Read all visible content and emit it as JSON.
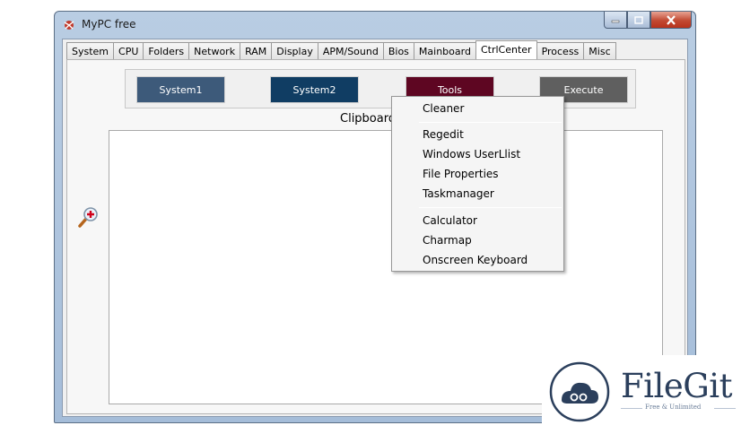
{
  "window": {
    "title": "MyPC free"
  },
  "tabs": [
    {
      "label": "System"
    },
    {
      "label": "CPU"
    },
    {
      "label": "Folders"
    },
    {
      "label": "Network"
    },
    {
      "label": "RAM"
    },
    {
      "label": "Display"
    },
    {
      "label": "APM/Sound"
    },
    {
      "label": "Bios"
    },
    {
      "label": "Mainboard"
    },
    {
      "label": "CtrlCenter",
      "active": true
    },
    {
      "label": "Process"
    },
    {
      "label": "Misc"
    }
  ],
  "buttons": {
    "system1": "System1",
    "system2": "System2",
    "tools": "Tools",
    "execute": "Execute"
  },
  "clipboard_label": "Clipboard V",
  "menu": {
    "items": [
      "Cleaner",
      "Regedit",
      "Windows UserLlist",
      "File Properties",
      "Taskmanager",
      "Calculator",
      "Charmap",
      "Onscreen Keyboard"
    ]
  },
  "watermark": {
    "name": "FileGit",
    "tagline": "Free & Unlimited",
    "color": "#2b3f5c"
  },
  "colors": {
    "system1": "#3d5a7a",
    "system2": "#103d63",
    "tools": "#5e0622",
    "execute": "#5f5f5f"
  }
}
